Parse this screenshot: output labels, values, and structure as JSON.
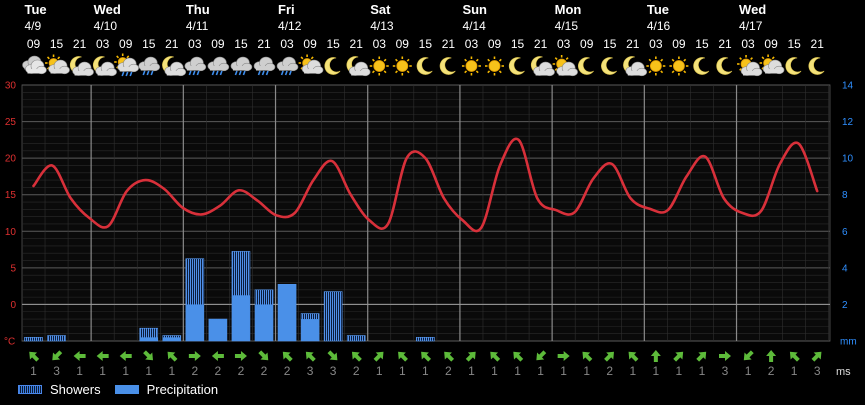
{
  "chart_data": {
    "type": "line",
    "days": [
      {
        "name": "Tue",
        "date": "4/9",
        "slot": 0
      },
      {
        "name": "Wed",
        "date": "4/10",
        "slot": 3
      },
      {
        "name": "Thu",
        "date": "4/11",
        "slot": 7
      },
      {
        "name": "Fri",
        "date": "4/12",
        "slot": 11
      },
      {
        "name": "Sat",
        "date": "4/13",
        "slot": 15
      },
      {
        "name": "Sun",
        "date": "4/14",
        "slot": 19
      },
      {
        "name": "Mon",
        "date": "4/15",
        "slot": 23
      },
      {
        "name": "Tue",
        "date": "4/16",
        "slot": 27
      },
      {
        "name": "Wed",
        "date": "4/17",
        "slot": 31
      }
    ],
    "hours": [
      "09",
      "15",
      "21",
      "03",
      "09",
      "15",
      "21",
      "03",
      "09",
      "15",
      "21",
      "03",
      "09",
      "15",
      "21",
      "03",
      "09",
      "15",
      "21",
      "03",
      "09",
      "15",
      "21",
      "03",
      "09",
      "15",
      "21",
      "03",
      "09",
      "15",
      "21",
      "03",
      "09",
      "15",
      "21"
    ],
    "icons": [
      "cloudy",
      "partly-sunny",
      "moon-cloud",
      "moon-cloud",
      "sun-cloud-rain",
      "cloud-rain",
      "moon-cloud",
      "cloud-rain",
      "cloud-rain",
      "cloud-rain",
      "cloud-rain",
      "cloud-rain",
      "partly-sunny",
      "moon",
      "moon-cloud",
      "sun",
      "sun",
      "moon",
      "moon",
      "sun",
      "sun",
      "moon",
      "moon-cloud",
      "sun-cloud",
      "moon",
      "moon",
      "moon-cloud",
      "sun",
      "sun",
      "moon",
      "moon",
      "sun-cloud",
      "partly-sunny",
      "moon",
      "moon"
    ],
    "temperature": {
      "unit": "°C",
      "ylim": [
        -5,
        30
      ],
      "ticks": [
        30,
        25,
        20,
        15,
        10,
        5,
        0,
        -5
      ],
      "values": [
        16.2,
        19.0,
        14.5,
        11.8,
        10.7,
        15.5,
        17.0,
        15.8,
        13.2,
        12.3,
        13.5,
        15.6,
        14.2,
        12.2,
        12.5,
        17.0,
        19.6,
        15.0,
        11.5,
        11.0,
        20.0,
        20.0,
        14.5,
        11.5,
        10.5,
        19.0,
        22.5,
        14.5,
        12.9,
        12.6,
        17.2,
        19.2,
        14.5,
        13.1,
        12.9,
        17.5,
        20.2,
        14.5,
        12.5,
        12.8,
        19.2,
        22.0,
        15.5
      ]
    },
    "precipitation": {
      "unit": "mm",
      "ylim": [
        0,
        14
      ],
      "ticks": [
        14,
        12,
        10,
        8,
        6,
        4,
        2
      ],
      "showers": [
        0.2,
        0.3,
        0,
        0,
        0,
        0.7,
        0.3,
        4.5,
        1.2,
        4.9,
        2.8,
        3.1,
        1.5,
        2.7,
        0.3,
        0,
        0,
        0.2,
        0,
        0,
        0,
        0,
        0,
        0,
        0,
        0,
        0,
        0,
        0,
        0,
        0,
        0,
        0,
        0,
        0
      ],
      "precipitation": [
        0,
        0,
        0,
        0,
        0,
        0.2,
        0.2,
        2.0,
        1.2,
        2.5,
        2.0,
        3.1,
        1.2,
        0,
        0,
        0,
        0,
        0,
        0,
        0,
        0,
        0,
        0,
        0,
        0,
        0,
        0,
        0,
        0,
        0,
        0,
        0,
        0,
        0,
        0
      ]
    },
    "wind": {
      "unit": "ms",
      "arrows": [
        "sw",
        "se",
        "w",
        "w",
        "w",
        "nw",
        "sw",
        "e",
        "w",
        "e",
        "nw",
        "sw",
        "sw",
        "nw",
        "sw",
        "ne",
        "sw",
        "sw",
        "sw",
        "ne",
        "sw",
        "sw",
        "se",
        "e",
        "sw",
        "ne",
        "sw",
        "s",
        "ne",
        "ne",
        "e",
        "se",
        "s",
        "sw",
        "ne",
        "se",
        "ne"
      ],
      "dirs_deg": [
        315,
        225,
        270,
        270,
        270,
        135,
        315,
        90,
        270,
        90,
        135,
        315,
        315,
        135,
        315,
        45,
        315,
        315,
        315,
        45,
        315,
        315,
        225,
        90,
        315,
        45,
        315,
        0,
        45,
        45,
        90,
        225,
        0,
        315,
        45,
        225,
        45
      ],
      "speeds": [
        "1",
        "3",
        "1",
        "1",
        "1",
        "1",
        "1",
        "2",
        "2",
        "2",
        "2",
        "2",
        "3",
        "3",
        "2",
        "1",
        "1",
        "1",
        "2",
        "1",
        "1",
        "1",
        "1",
        "1",
        "1",
        "2",
        "1",
        "1",
        "1",
        "1",
        "3",
        "1",
        "2",
        "1",
        "3",
        "1",
        "1",
        "2",
        "2",
        "1",
        "2",
        "2"
      ]
    },
    "legend": [
      {
        "label": "Showers",
        "style": "hatched"
      },
      {
        "label": "Precipitation",
        "style": "solid"
      }
    ],
    "grid": true,
    "colors": {
      "temperature": "#d8303a",
      "precipitation": "#4a90e8",
      "left_axis": "#e03030",
      "right_axis": "#2f8fff",
      "background": "#000000",
      "grid": "#3a3a3a"
    }
  }
}
